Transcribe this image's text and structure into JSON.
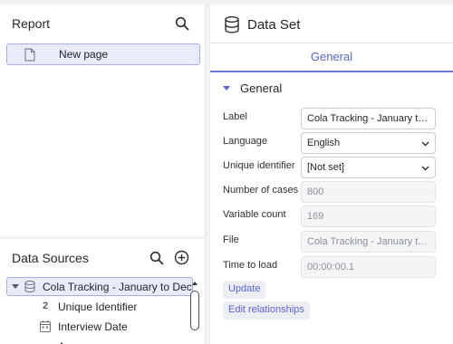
{
  "report": {
    "title": "Report",
    "pages": [
      {
        "label": "New page"
      }
    ]
  },
  "data_sources": {
    "title": "Data Sources",
    "source": {
      "label": "Cola Tracking - January to December"
    },
    "variables": [
      {
        "icon": "2",
        "label": "Unique Identifier"
      },
      {
        "icon": "calendar",
        "label": "Interview Date"
      },
      {
        "icon": "",
        "label": "A"
      }
    ]
  },
  "data_set": {
    "title": "Data Set",
    "tab": "General",
    "section": "General",
    "fields": {
      "label": {
        "name": "Label",
        "value": "Cola Tracking - January to December"
      },
      "language": {
        "name": "Language",
        "value": "English"
      },
      "unique_identifier": {
        "name": "Unique identifier",
        "value": "[Not set]"
      },
      "number_of_cases": {
        "name": "Number of cases",
        "value": "800"
      },
      "variable_count": {
        "name": "Variable count",
        "value": "169"
      },
      "file": {
        "name": "File",
        "value": "Cola Tracking - January to December"
      },
      "time_to_load": {
        "name": "Time to load",
        "value": "00:00:00.1"
      }
    },
    "buttons": {
      "update": "Update",
      "edit_relationships": "Edit relationships"
    }
  }
}
